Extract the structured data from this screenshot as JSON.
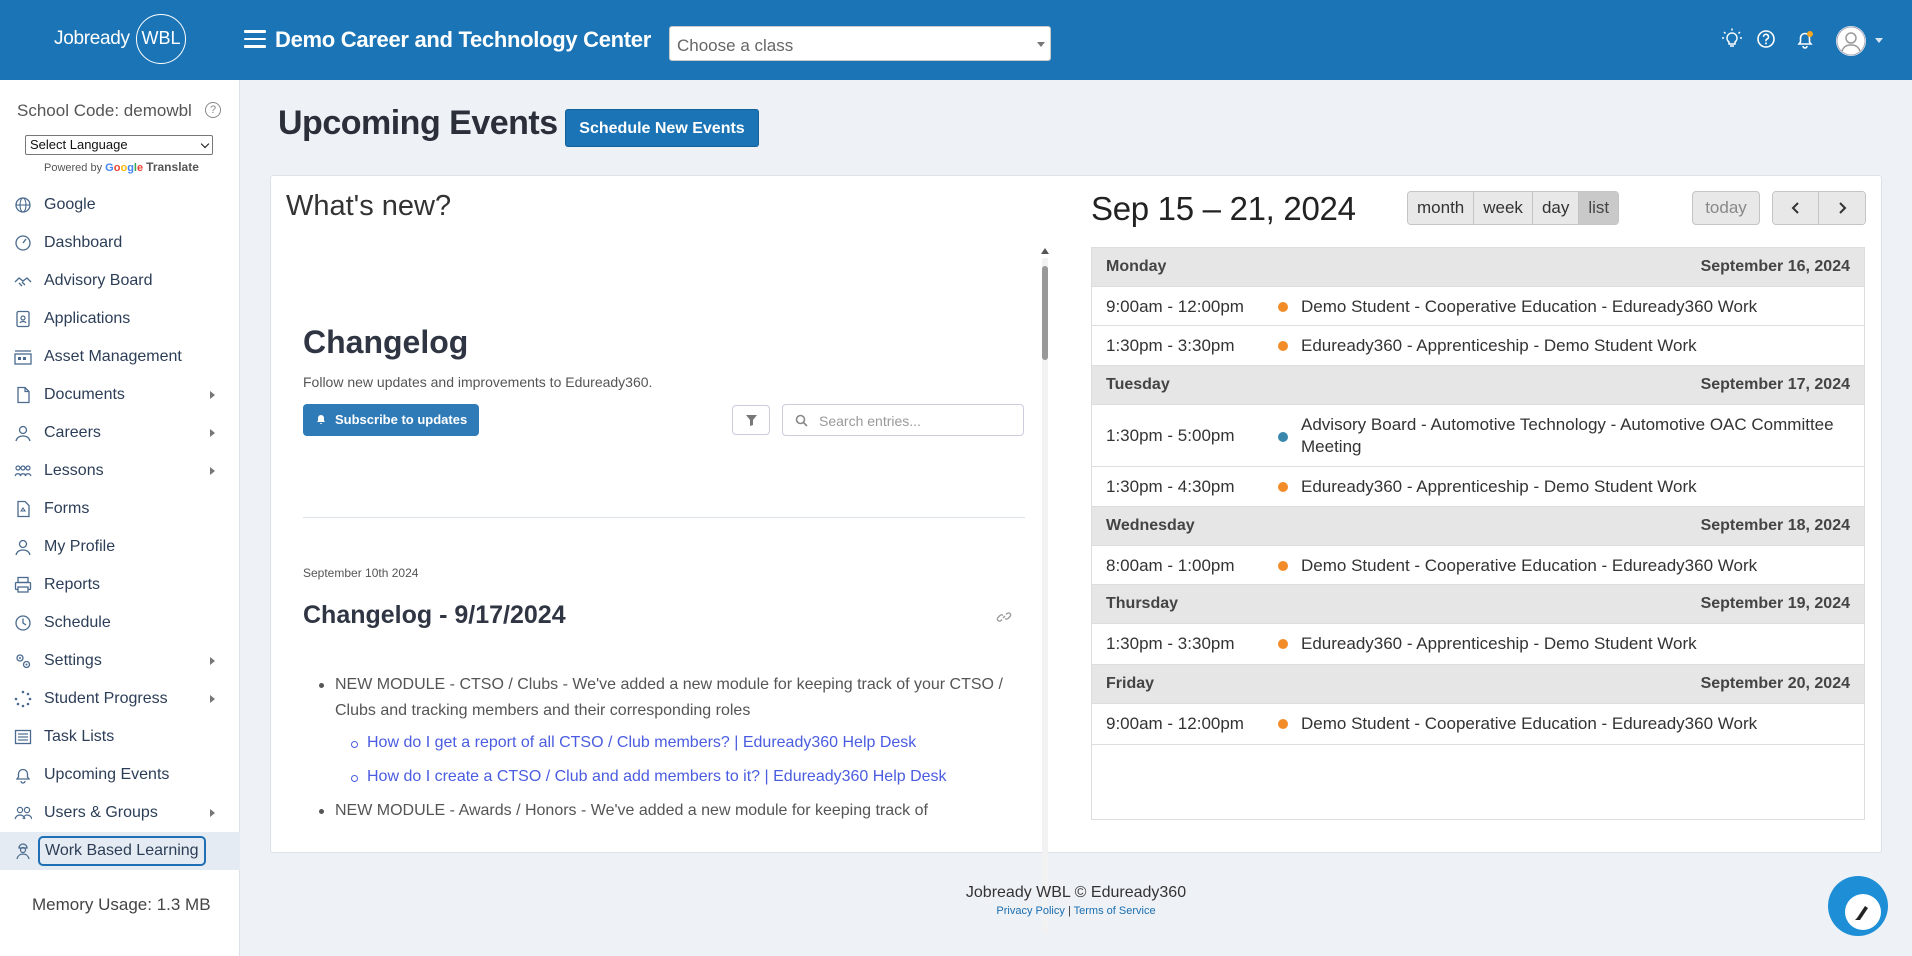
{
  "header": {
    "logo_word": "Jobready",
    "logo_badge": "WBL",
    "org_title": "Demo Career and Technology Center",
    "class_select_placeholder": "Choose a class"
  },
  "sidebar": {
    "school_code": "School Code: demowbl",
    "language_select": "Select Language",
    "powered_by": "Powered by",
    "google": "Google",
    "translate": "Translate",
    "items": [
      {
        "label": "Google",
        "icon": "globe-icon",
        "submenu": false
      },
      {
        "label": "Dashboard",
        "icon": "dashboard-icon",
        "submenu": false
      },
      {
        "label": "Advisory Board",
        "icon": "handshake-icon",
        "submenu": false
      },
      {
        "label": "Applications",
        "icon": "application-icon",
        "submenu": false
      },
      {
        "label": "Asset Management",
        "icon": "asset-icon",
        "submenu": false
      },
      {
        "label": "Documents",
        "icon": "document-icon",
        "submenu": true
      },
      {
        "label": "Careers",
        "icon": "person-icon",
        "submenu": true
      },
      {
        "label": "Lessons",
        "icon": "lessons-icon",
        "submenu": true
      },
      {
        "label": "Forms",
        "icon": "form-icon",
        "submenu": false
      },
      {
        "label": "My Profile",
        "icon": "profile-icon",
        "submenu": false
      },
      {
        "label": "Reports",
        "icon": "printer-icon",
        "submenu": false
      },
      {
        "label": "Schedule",
        "icon": "clock-icon",
        "submenu": false
      },
      {
        "label": "Settings",
        "icon": "settings-icon",
        "submenu": true
      },
      {
        "label": "Student Progress",
        "icon": "progress-icon",
        "submenu": true
      },
      {
        "label": "Task Lists",
        "icon": "list-icon",
        "submenu": false
      },
      {
        "label": "Upcoming Events",
        "icon": "bell-icon",
        "submenu": false
      },
      {
        "label": "Users & Groups",
        "icon": "users-icon",
        "submenu": true
      },
      {
        "label": "Work Based Learning",
        "icon": "worker-icon",
        "submenu": false
      }
    ],
    "memory_usage": "Memory Usage: 1.3 MB"
  },
  "main": {
    "page_title": "Upcoming Events",
    "schedule_button": "Schedule New Events",
    "whats_new": "What's new?"
  },
  "changelog": {
    "title": "Changelog",
    "subtitle": "Follow new updates and improvements to Eduready360.",
    "subscribe_button": "Subscribe to updates",
    "search_placeholder": "Search entries...",
    "entry_date": "September 10th 2024",
    "entry_title": "Changelog - 9/17/2024",
    "bullet1": "NEW MODULE - CTSO / Clubs - We've added a new module for keeping track of your CTSO / Clubs and tracking members and their corresponding roles",
    "link1": "How do I get a report of all CTSO / Club members? | Eduready360 Help Desk",
    "link2": "How do I create a CTSO / Club and add members to it? | Eduready360 Help Desk",
    "bullet2": "NEW MODULE - Awards / Honors - We've added a new module for keeping track of"
  },
  "calendar": {
    "range_title": "Sep 15 – 21, 2024",
    "views": [
      "month",
      "week",
      "day",
      "list"
    ],
    "active_view": "list",
    "today_label": "today",
    "days": [
      {
        "name": "Monday",
        "date": "September 16, 2024"
      },
      {
        "name": "Tuesday",
        "date": "September 17, 2024"
      },
      {
        "name": "Wednesday",
        "date": "September 18, 2024"
      },
      {
        "name": "Thursday",
        "date": "September 19, 2024"
      },
      {
        "name": "Friday",
        "date": "September 20, 2024"
      }
    ],
    "events": [
      {
        "time": "9:00am - 12:00pm",
        "title": "Demo Student - Cooperative Education - Eduready360 Work",
        "color": "#f28c28"
      },
      {
        "time": "1:30pm - 3:30pm",
        "title": "Eduready360 - Apprenticeship - Demo Student Work",
        "color": "#f28c28"
      },
      {
        "time": "1:30pm - 5:00pm",
        "title": "Advisory Board - Automotive Technology - Automotive OAC Committee Meeting",
        "color": "#3a87ad"
      },
      {
        "time": "1:30pm - 4:30pm",
        "title": "Eduready360 - Apprenticeship - Demo Student Work",
        "color": "#f28c28"
      },
      {
        "time": "8:00am - 1:00pm",
        "title": "Demo Student - Cooperative Education - Eduready360 Work",
        "color": "#f28c28"
      },
      {
        "time": "1:30pm - 3:30pm",
        "title": "Eduready360 - Apprenticeship - Demo Student Work",
        "color": "#f28c28"
      },
      {
        "time": "9:00am - 12:00pm",
        "title": "Demo Student - Cooperative Education - Eduready360 Work",
        "color": "#f28c28"
      }
    ]
  },
  "footer": {
    "copyright": "Jobready WBL © Eduready360",
    "privacy": "Privacy Policy",
    "separator": "|",
    "terms": "Terms of Service"
  },
  "colors": {
    "brand": "#1a74b5",
    "event_orange": "#f28c28",
    "event_blue": "#3a87ad"
  }
}
